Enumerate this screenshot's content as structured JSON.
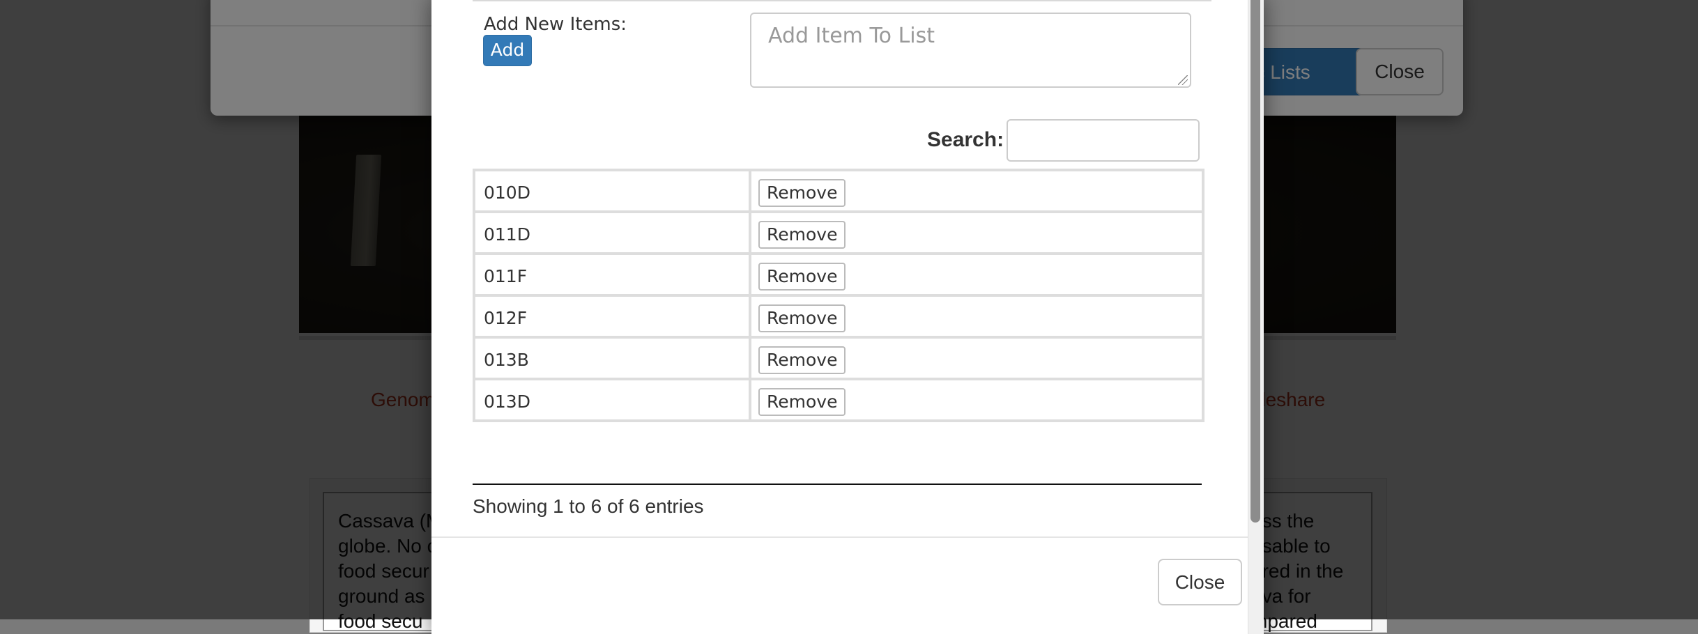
{
  "background": {
    "links": {
      "left_partial": "Genom",
      "right_partial": "deshare"
    },
    "description_lines": [
      {
        "left": "Cassava (M",
        "right": "oss the"
      },
      {
        "left": "globe. No c",
        "right": "nsable to"
      },
      {
        "left": "food secur",
        "right": "ored in the"
      },
      {
        "left": "ground as",
        "right": "ava for"
      },
      {
        "left": "food secu",
        "right": "mpared"
      }
    ]
  },
  "modal_behind": {
    "primary_button_partial": "ic Lists",
    "close_label": "Close",
    "colors": {
      "primary": "#337ab7"
    }
  },
  "list_modal": {
    "add_label": "Add New Items:",
    "add_button_label": "Add",
    "add_placeholder": "Add Item To List",
    "search_label": "Search:",
    "search_value": "",
    "items": [
      {
        "name": "010D",
        "action": "Remove"
      },
      {
        "name": "011D",
        "action": "Remove"
      },
      {
        "name": "011F",
        "action": "Remove"
      },
      {
        "name": "012F",
        "action": "Remove"
      },
      {
        "name": "013B",
        "action": "Remove"
      },
      {
        "name": "013D",
        "action": "Remove"
      }
    ],
    "info": "Showing 1 to 6 of 6 entries",
    "close_label": "Close"
  }
}
